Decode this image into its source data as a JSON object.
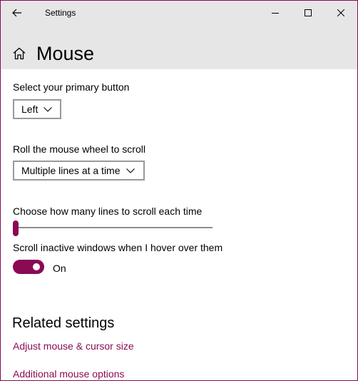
{
  "window": {
    "title": "Settings",
    "controls": {
      "back": "back-arrow-icon",
      "minimize": "minimize-icon",
      "maximize": "maximize-icon",
      "close": "close-icon"
    }
  },
  "page": {
    "title": "Mouse",
    "icon": "home-icon"
  },
  "primary_button": {
    "label": "Select your primary button",
    "value": "Left"
  },
  "wheel": {
    "label": "Roll the mouse wheel to scroll",
    "value": "Multiple lines at a time"
  },
  "lines": {
    "label": "Choose how many lines to scroll each time",
    "slider_fraction": 0.0
  },
  "inactive_scroll": {
    "label": "Scroll inactive windows when I hover over them",
    "state": "On"
  },
  "related": {
    "heading": "Related settings",
    "links": [
      "Adjust mouse & cursor size",
      "Additional mouse options"
    ]
  },
  "colors": {
    "accent": "#8a0a54",
    "header_bg": "#e6e6e6",
    "control_border": "#999999"
  }
}
